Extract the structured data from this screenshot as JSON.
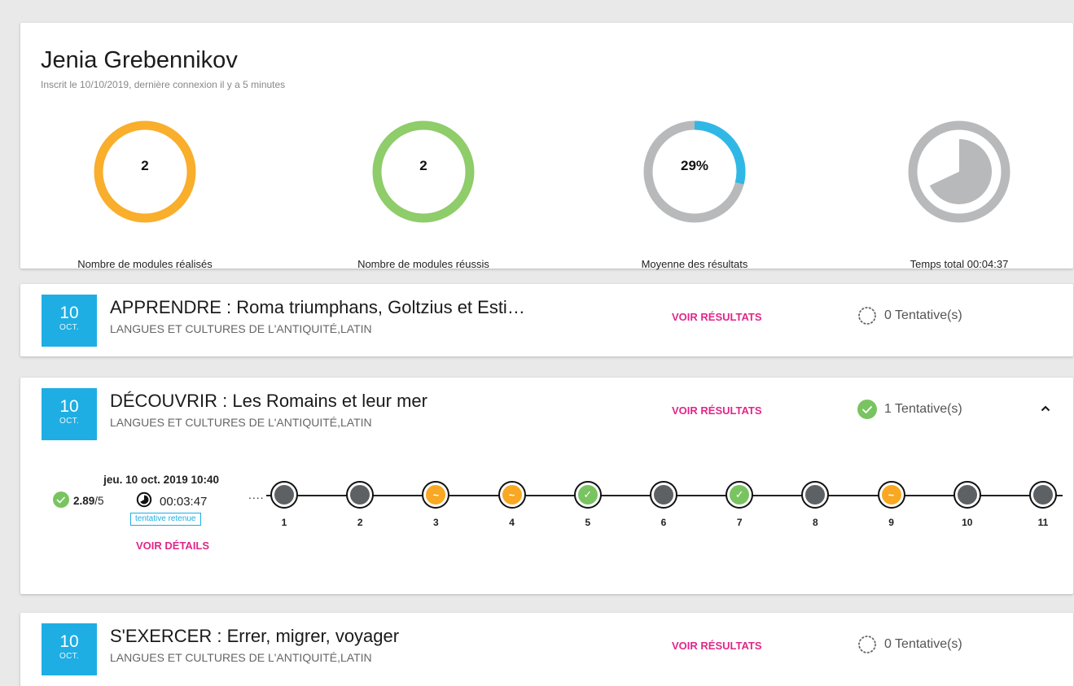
{
  "profile": {
    "name": "Jenia Grebennikov",
    "meta": "Inscrit le 10/10/2019, dernière connexion il y a 5 minutes",
    "stats": [
      {
        "value": "2",
        "label": "Nombre de modules réalisés",
        "color": "#f9ae2c",
        "fraction": 1.0
      },
      {
        "value": "2",
        "label": "Nombre de modules réussis",
        "color": "#8fcc6a",
        "fraction": 1.0
      },
      {
        "value": "29%",
        "label": "Moyenne des résultats",
        "color": "#2fb8e6",
        "track_color": "#b7b9ba",
        "fraction": 0.29
      },
      {
        "label": "Temps total 00:04:37",
        "color": "#b7b9ba",
        "fraction": 0.62
      }
    ]
  },
  "colors": {
    "accent_blue": "#1eaee3",
    "link_pink": "#e0278a",
    "node_gray": "#5e6164",
    "node_orange": "#f9a823",
    "node_green": "#79c461"
  },
  "modules": [
    {
      "day": "10",
      "month": "OCT.",
      "title": "APPRENDRE : Roma triumphans, Goltzius et Esti…",
      "subtitle": "LANGUES ET CULTURES DE L'ANTIQUITÉ,LATIN",
      "results_link": "VOIR RÉSULTATS",
      "attempts": "0 Tentative(s)",
      "attempt_icon": "dotted-circle-icon"
    },
    {
      "day": "10",
      "month": "OCT.",
      "title": "DÉCOUVRIR : Les Romains et leur mer",
      "subtitle": "LANGUES ET CULTURES DE L'ANTIQUITÉ,LATIN",
      "results_link": "VOIR RÉSULTATS",
      "attempts": "1 Tentative(s)",
      "attempt_icon": "check-circle-icon",
      "expanded": true,
      "attempt": {
        "date": "jeu. 10 oct. 2019 10:40",
        "score": "2.89",
        "score_max": "/5",
        "duration": "00:03:47",
        "retenue": "tentative retenue",
        "details_link": "VOIR DÉTAILS",
        "steps": [
          {
            "num": "1",
            "status": "gray"
          },
          {
            "num": "2",
            "status": "gray"
          },
          {
            "num": "3",
            "status": "orange"
          },
          {
            "num": "4",
            "status": "orange"
          },
          {
            "num": "5",
            "status": "green"
          },
          {
            "num": "6",
            "status": "gray"
          },
          {
            "num": "7",
            "status": "green"
          },
          {
            "num": "8",
            "status": "gray"
          },
          {
            "num": "9",
            "status": "orange"
          },
          {
            "num": "10",
            "status": "gray"
          },
          {
            "num": "11",
            "status": "gray"
          }
        ]
      }
    },
    {
      "day": "10",
      "month": "OCT.",
      "title": "S'EXERCER : Errer, migrer, voyager",
      "subtitle": "LANGUES ET CULTURES DE L'ANTIQUITÉ,LATIN",
      "results_link": "VOIR RÉSULTATS",
      "attempts": "0 Tentative(s)",
      "attempt_icon": "dotted-circle-icon"
    }
  ]
}
